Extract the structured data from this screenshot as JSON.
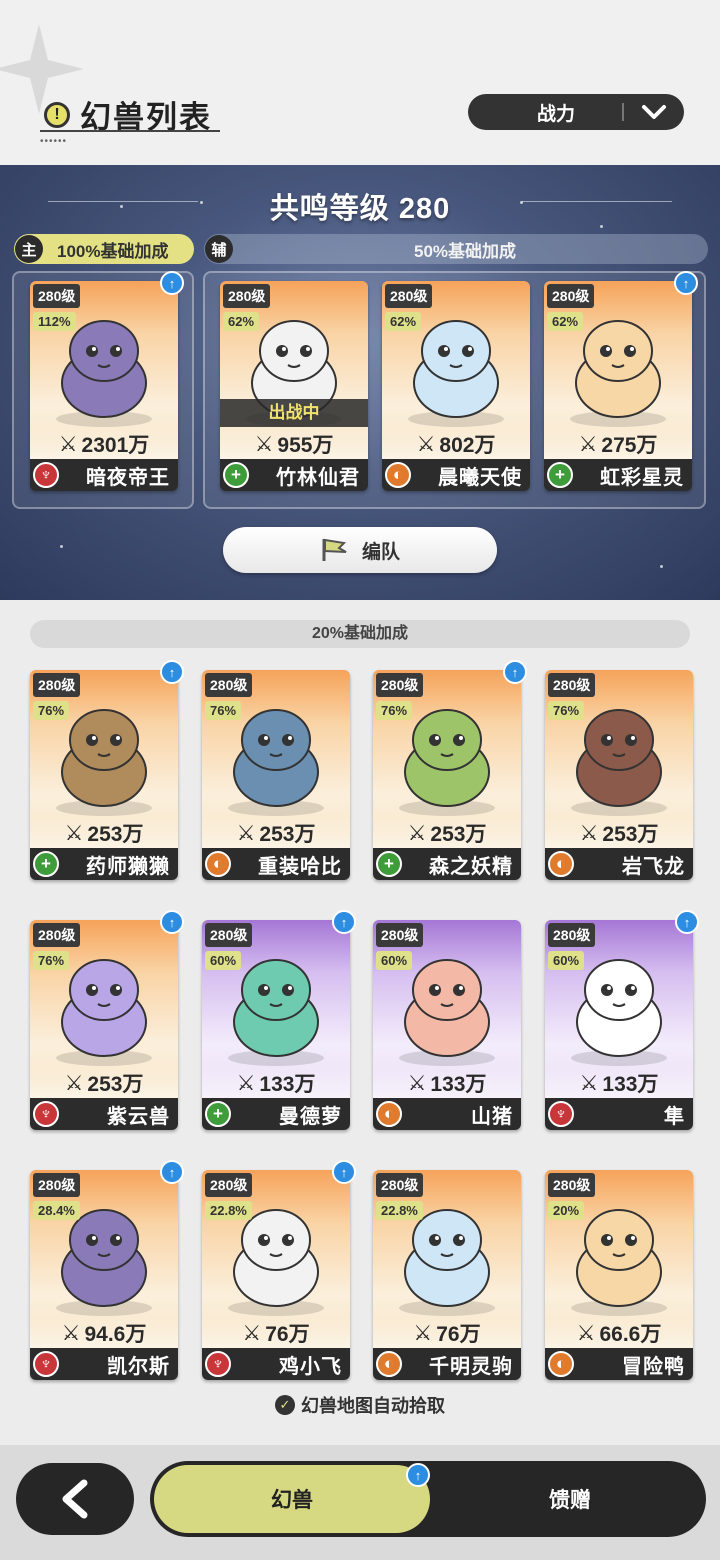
{
  "header": {
    "title": "幻兽列表",
    "sort_label": "战力"
  },
  "team": {
    "resonance_label": "共鸣等级 280",
    "main_badge": "主",
    "main_bonus": "100%基础加成",
    "assist_badge": "辅",
    "assist_bonus": "50%基础加成",
    "formation_label": "编队",
    "main": [
      {
        "level": "280级",
        "pct": "112%",
        "power": "2301万",
        "name": "暗夜帝王",
        "type": "attack",
        "upgrade": true,
        "deployed": false,
        "theme": "orange"
      }
    ],
    "assist": [
      {
        "level": "280级",
        "pct": "62%",
        "power": "955万",
        "name": "竹林仙君",
        "type": "heal",
        "upgrade": false,
        "deployed": true,
        "deploy_label": "出战中",
        "theme": "orange"
      },
      {
        "level": "280级",
        "pct": "62%",
        "power": "802万",
        "name": "晨曦天使",
        "type": "defense",
        "upgrade": false,
        "deployed": false,
        "theme": "orange"
      },
      {
        "level": "280级",
        "pct": "62%",
        "power": "275万",
        "name": "虹彩星灵",
        "type": "heal",
        "upgrade": true,
        "deployed": false,
        "theme": "orange"
      }
    ]
  },
  "list": {
    "bonus_label": "20%基础加成",
    "beasts": [
      {
        "level": "280级",
        "pct": "76%",
        "power": "253万",
        "name": "药师獭獭",
        "type": "heal",
        "upgrade": true,
        "theme": "orange"
      },
      {
        "level": "280级",
        "pct": "76%",
        "power": "253万",
        "name": "重装哈比",
        "type": "defense",
        "upgrade": false,
        "theme": "orange"
      },
      {
        "level": "280级",
        "pct": "76%",
        "power": "253万",
        "name": "森之妖精",
        "type": "heal",
        "upgrade": true,
        "theme": "orange"
      },
      {
        "level": "280级",
        "pct": "76%",
        "power": "253万",
        "name": "岩飞龙",
        "type": "defense",
        "upgrade": false,
        "theme": "orange"
      },
      {
        "level": "280级",
        "pct": "76%",
        "power": "253万",
        "name": "紫云兽",
        "type": "attack",
        "upgrade": true,
        "theme": "orange"
      },
      {
        "level": "280级",
        "pct": "60%",
        "power": "133万",
        "name": "曼德萝",
        "type": "heal",
        "upgrade": true,
        "theme": "purple"
      },
      {
        "level": "280级",
        "pct": "60%",
        "power": "133万",
        "name": "山猪",
        "type": "defense",
        "upgrade": false,
        "theme": "purple"
      },
      {
        "level": "280级",
        "pct": "60%",
        "power": "133万",
        "name": "隼",
        "type": "attack",
        "upgrade": true,
        "theme": "purple"
      },
      {
        "level": "280级",
        "pct": "28.4%",
        "power": "94.6万",
        "name": "凯尔斯",
        "type": "attack",
        "upgrade": true,
        "theme": "orange"
      },
      {
        "level": "280级",
        "pct": "22.8%",
        "power": "76万",
        "name": "鸡小飞",
        "type": "attack",
        "upgrade": true,
        "theme": "orange"
      },
      {
        "level": "280级",
        "pct": "22.8%",
        "power": "76万",
        "name": "千明灵驹",
        "type": "defense",
        "upgrade": false,
        "theme": "orange"
      },
      {
        "level": "280级",
        "pct": "20%",
        "power": "66.6万",
        "name": "冒险鸭",
        "type": "defense",
        "upgrade": false,
        "theme": "orange"
      }
    ],
    "auto_pickup_label": "幻兽地图自动拾取"
  },
  "bottom_nav": {
    "tabs": [
      {
        "label": "幻兽",
        "active": true,
        "upgrade": true
      },
      {
        "label": "馈赠",
        "active": false
      }
    ]
  },
  "colors": {
    "accent": "#d7d882",
    "attack": "#c8363a",
    "heal": "#3f9c3a",
    "defense": "#e07b2e",
    "upgrade": "#2d8de0"
  }
}
